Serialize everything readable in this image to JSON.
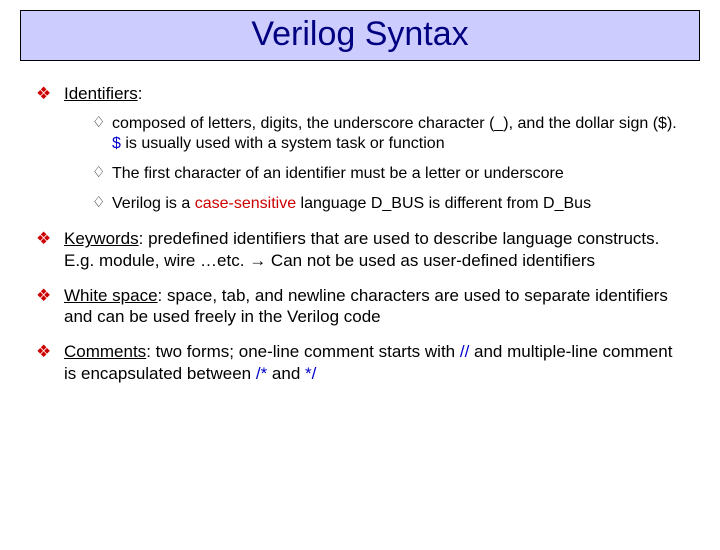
{
  "title": "Verilog Syntax",
  "sections": {
    "identifiers": {
      "head_label": "Identifiers",
      "head_colon": ":",
      "sub1_a": "composed of letters, digits, the underscore character (_), and the dollar sign ($). ",
      "sub1_b": "$",
      "sub1_c": " is usually used with a system task or function",
      "sub2": "The first character of an identifier must be a letter or underscore",
      "sub3_a": "Verilog is a ",
      "sub3_b": "case-sensitive",
      "sub3_c": " language D_BUS is different from D_Bus"
    },
    "keywords": {
      "label": "Keywords",
      "text_a": ": predefined identifiers that are used to describe language constructs. E.g. module, wire …etc. ",
      "arrow": "→",
      "text_b": " Can not be used as user-defined identifiers"
    },
    "whitespace": {
      "label": "White space",
      "text": ": space, tab, and newline characters are used to separate identifiers and can be used freely in the Verilog code"
    },
    "comments": {
      "label": "Comments",
      "text_a": ": two forms; one-line comment starts with ",
      "tok1": "//",
      "text_b": " and multiple-line comment is encapsulated between ",
      "tok2": "/*",
      "text_c": " and ",
      "tok3": "*/"
    }
  }
}
